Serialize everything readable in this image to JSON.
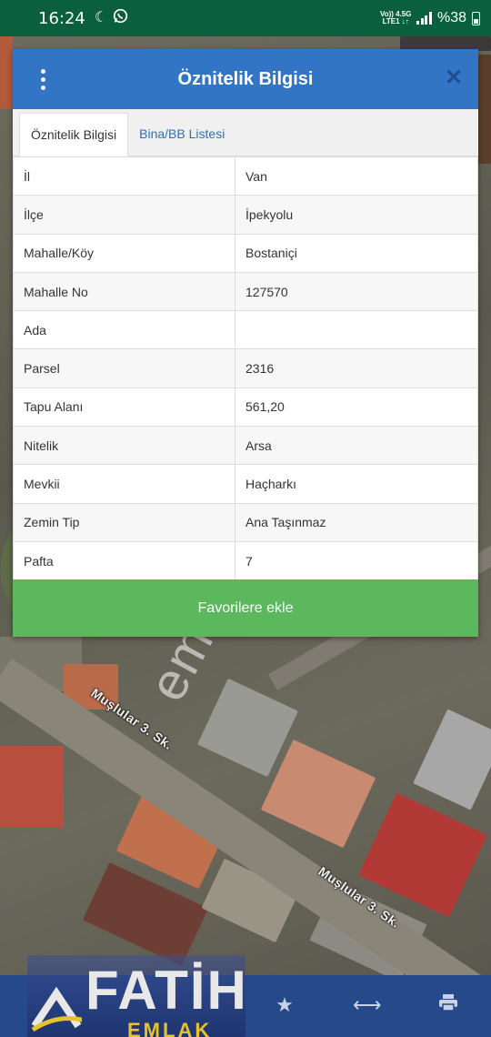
{
  "status_bar": {
    "time": "16:24",
    "network_top": "Vo)) 4.5G",
    "network_bottom": "LTE1 ↓↑",
    "battery": "%38"
  },
  "dialog": {
    "title": "Öznitelik Bilgisi",
    "tabs": [
      {
        "label": "Öznitelik Bilgisi",
        "active": true
      },
      {
        "label": "Bina/BB Listesi",
        "active": false
      }
    ],
    "rows": [
      {
        "key": "İl",
        "value": "Van"
      },
      {
        "key": "İlçe",
        "value": "İpekyolu"
      },
      {
        "key": "Mahalle/Köy",
        "value": "Bostaniçi"
      },
      {
        "key": "Mahalle No",
        "value": "127570"
      },
      {
        "key": "Ada",
        "value": ""
      },
      {
        "key": "Parsel",
        "value": "2316"
      },
      {
        "key": "Tapu Alanı",
        "value": "561,20"
      },
      {
        "key": "Nitelik",
        "value": "Arsa"
      },
      {
        "key": "Mevkii",
        "value": "Haçharkı"
      },
      {
        "key": "Zemin Tip",
        "value": "Ana Taşınmaz"
      },
      {
        "key": "Pafta",
        "value": "7"
      }
    ],
    "favorite_button": "Favorilere ekle"
  },
  "map": {
    "street_labels": [
      "Muşlular 3. Sk.",
      "Muşlular 3. Sk."
    ]
  },
  "watermark": "emlakjet.com",
  "logo": {
    "brand": "FATİH",
    "sub": "EMLAK"
  },
  "colors": {
    "header": "#3275c4",
    "button": "#5cb85c",
    "status_bar": "#0a5f3e",
    "bottom_bar": "#26498a"
  }
}
